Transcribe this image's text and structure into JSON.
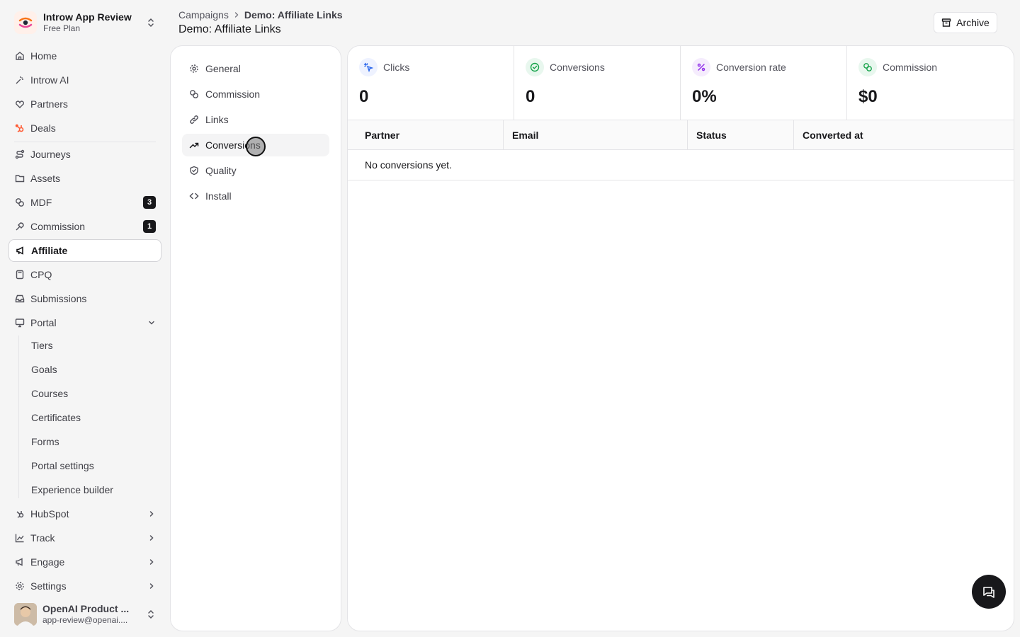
{
  "workspace": {
    "name": "Introw App Review",
    "plan": "Free Plan"
  },
  "sidebar": {
    "items": [
      {
        "label": "Home",
        "icon": "home-icon"
      },
      {
        "label": "Introw AI",
        "icon": "sparkle-icon"
      },
      {
        "label": "Partners",
        "icon": "handshake-icon"
      },
      {
        "label": "Deals",
        "icon": "hubspot-icon"
      },
      {
        "label": "Journeys",
        "icon": "route-icon"
      },
      {
        "label": "Assets",
        "icon": "folder-icon"
      },
      {
        "label": "MDF",
        "icon": "coins-icon",
        "badge": "3"
      },
      {
        "label": "Commission",
        "icon": "wrench-icon",
        "badge": "1"
      },
      {
        "label": "Affiliate",
        "icon": "megaphone-icon"
      },
      {
        "label": "CPQ",
        "icon": "calculator-icon"
      },
      {
        "label": "Submissions",
        "icon": "inbox-icon"
      },
      {
        "label": "Portal",
        "icon": "monitor-icon"
      }
    ],
    "portal_children": [
      "Tiers",
      "Goals",
      "Courses",
      "Certificates",
      "Forms",
      "Portal settings",
      "Experience builder"
    ],
    "groups": [
      {
        "label": "HubSpot",
        "icon": "hubspot-icon"
      },
      {
        "label": "Track",
        "icon": "chart-icon"
      },
      {
        "label": "Engage",
        "icon": "megaphone-icon"
      },
      {
        "label": "Settings",
        "icon": "gear-icon"
      }
    ]
  },
  "user": {
    "name": "OpenAI Product ...",
    "email": "app-review@openai...."
  },
  "header": {
    "breadcrumb_root": "Campaigns",
    "breadcrumb_current": "Demo: Affiliate Links",
    "title": "Demo: Affiliate Links",
    "archive_label": "Archive"
  },
  "campaign_nav": {
    "items": [
      {
        "label": "General",
        "icon": "gear-icon"
      },
      {
        "label": "Commission",
        "icon": "coins-icon"
      },
      {
        "label": "Links",
        "icon": "link-icon"
      },
      {
        "label": "Conversions",
        "icon": "trending-up-icon"
      },
      {
        "label": "Quality",
        "icon": "shield-check-icon"
      },
      {
        "label": "Install",
        "icon": "code-icon"
      }
    ],
    "active": "Conversions"
  },
  "stats": [
    {
      "label": "Clicks",
      "value": "0",
      "icon": "pointer-click-icon",
      "color": "#2563eb",
      "bg": "#eef2ff"
    },
    {
      "label": "Conversions",
      "value": "0",
      "icon": "check-circle-icon",
      "color": "#16a34a",
      "bg": "#e8f7ee"
    },
    {
      "label": "Conversion rate",
      "value": "0%",
      "icon": "percent-icon",
      "color": "#9333ea",
      "bg": "#f5ecfd"
    },
    {
      "label": "Commission",
      "value": "$0",
      "icon": "coins-icon",
      "color": "#16a34a",
      "bg": "#e8f7ee"
    }
  ],
  "table": {
    "columns": [
      "Partner",
      "Email",
      "Status",
      "Converted at"
    ],
    "empty_message": "No conversions yet."
  },
  "colors": {
    "accent": "#18181b",
    "hubspot": "#ff5c35",
    "background": "#f5f5f5"
  }
}
